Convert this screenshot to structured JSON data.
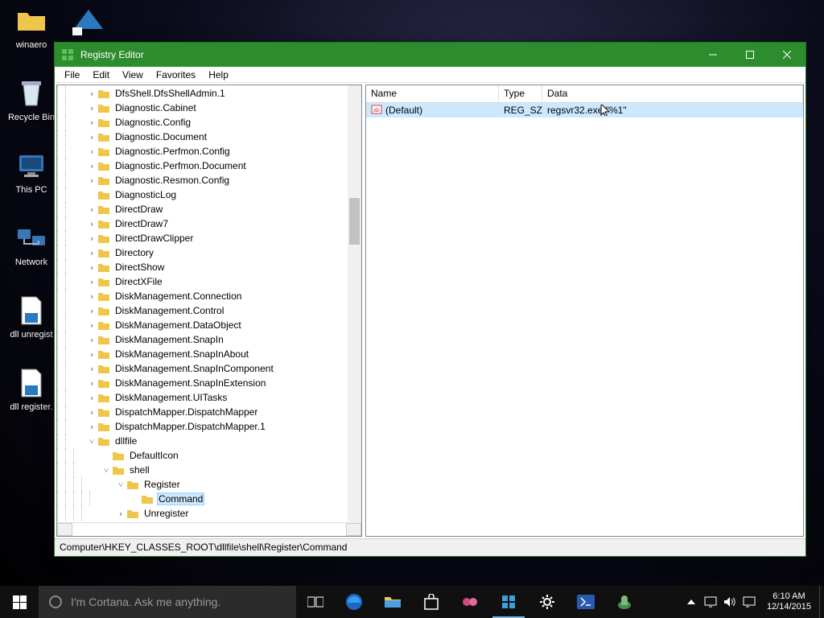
{
  "desktop_icons": [
    {
      "label": "winaero"
    },
    {
      "label": "Recycle Bin"
    },
    {
      "label": "This PC"
    },
    {
      "label": "Network"
    },
    {
      "label": "dll unregist"
    },
    {
      "label": "dll register."
    }
  ],
  "window": {
    "title": "Registry Editor",
    "menu": [
      "File",
      "Edit",
      "View",
      "Favorites",
      "Help"
    ],
    "statusbar": "Computer\\HKEY_CLASSES_ROOT\\dllfile\\shell\\Register\\Command"
  },
  "tree": [
    {
      "indent": 0,
      "exp": ">",
      "label": "DfsShell.DfsShellAdmin.1"
    },
    {
      "indent": 0,
      "exp": ">",
      "label": "Diagnostic.Cabinet"
    },
    {
      "indent": 0,
      "exp": ">",
      "label": "Diagnostic.Config"
    },
    {
      "indent": 0,
      "exp": ">",
      "label": "Diagnostic.Document"
    },
    {
      "indent": 0,
      "exp": ">",
      "label": "Diagnostic.Perfmon.Config"
    },
    {
      "indent": 0,
      "exp": ">",
      "label": "Diagnostic.Perfmon.Document"
    },
    {
      "indent": 0,
      "exp": ">",
      "label": "Diagnostic.Resmon.Config"
    },
    {
      "indent": 0,
      "exp": "",
      "label": "DiagnosticLog"
    },
    {
      "indent": 0,
      "exp": ">",
      "label": "DirectDraw"
    },
    {
      "indent": 0,
      "exp": ">",
      "label": "DirectDraw7"
    },
    {
      "indent": 0,
      "exp": ">",
      "label": "DirectDrawClipper"
    },
    {
      "indent": 0,
      "exp": ">",
      "label": "Directory"
    },
    {
      "indent": 0,
      "exp": ">",
      "label": "DirectShow"
    },
    {
      "indent": 0,
      "exp": ">",
      "label": "DirectXFile"
    },
    {
      "indent": 0,
      "exp": ">",
      "label": "DiskManagement.Connection"
    },
    {
      "indent": 0,
      "exp": ">",
      "label": "DiskManagement.Control"
    },
    {
      "indent": 0,
      "exp": ">",
      "label": "DiskManagement.DataObject"
    },
    {
      "indent": 0,
      "exp": ">",
      "label": "DiskManagement.SnapIn"
    },
    {
      "indent": 0,
      "exp": ">",
      "label": "DiskManagement.SnapInAbout"
    },
    {
      "indent": 0,
      "exp": ">",
      "label": "DiskManagement.SnapInComponent"
    },
    {
      "indent": 0,
      "exp": ">",
      "label": "DiskManagement.SnapInExtension"
    },
    {
      "indent": 0,
      "exp": ">",
      "label": "DiskManagement.UITasks"
    },
    {
      "indent": 0,
      "exp": ">",
      "label": "DispatchMapper.DispatchMapper"
    },
    {
      "indent": 0,
      "exp": ">",
      "label": "DispatchMapper.DispatchMapper.1"
    },
    {
      "indent": 0,
      "exp": "v",
      "label": "dllfile"
    },
    {
      "indent": 1,
      "exp": "",
      "label": "DefaultIcon"
    },
    {
      "indent": 1,
      "exp": "v",
      "label": "shell"
    },
    {
      "indent": 2,
      "exp": "v",
      "label": "Register"
    },
    {
      "indent": 3,
      "exp": "",
      "label": "Command",
      "selected": true
    },
    {
      "indent": 2,
      "exp": ">",
      "label": "Unregister"
    }
  ],
  "list": {
    "headers": {
      "name": "Name",
      "type": "Type",
      "data": "Data"
    },
    "rows": [
      {
        "name": "(Default)",
        "type": "REG_SZ",
        "data": "regsvr32.exe \"%1\"",
        "selected": true
      }
    ]
  },
  "taskbar": {
    "cortana_placeholder": "I'm Cortana. Ask me anything.",
    "clock_time": "6:10 AM",
    "clock_date": "12/14/2015"
  }
}
